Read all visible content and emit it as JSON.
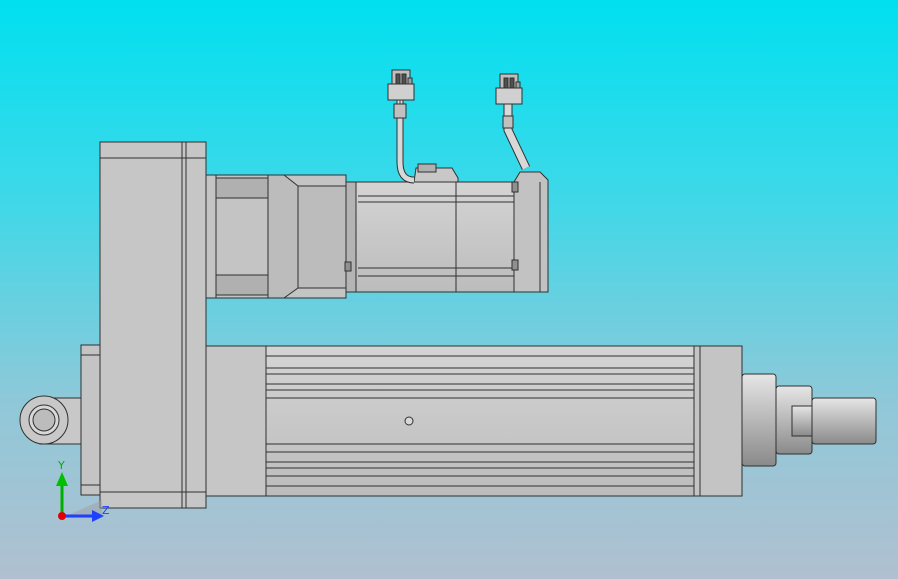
{
  "viewport": {
    "background_top": "#00e0f0",
    "background_bottom": "#b0c0d0",
    "model_fill": "#c8c8c8",
    "model_edge": "#303030"
  },
  "triad": {
    "y_label": "Y",
    "z_label": "Z",
    "y_color": "#00b000",
    "z_color": "#2040ff",
    "origin_color": "#e00000"
  }
}
